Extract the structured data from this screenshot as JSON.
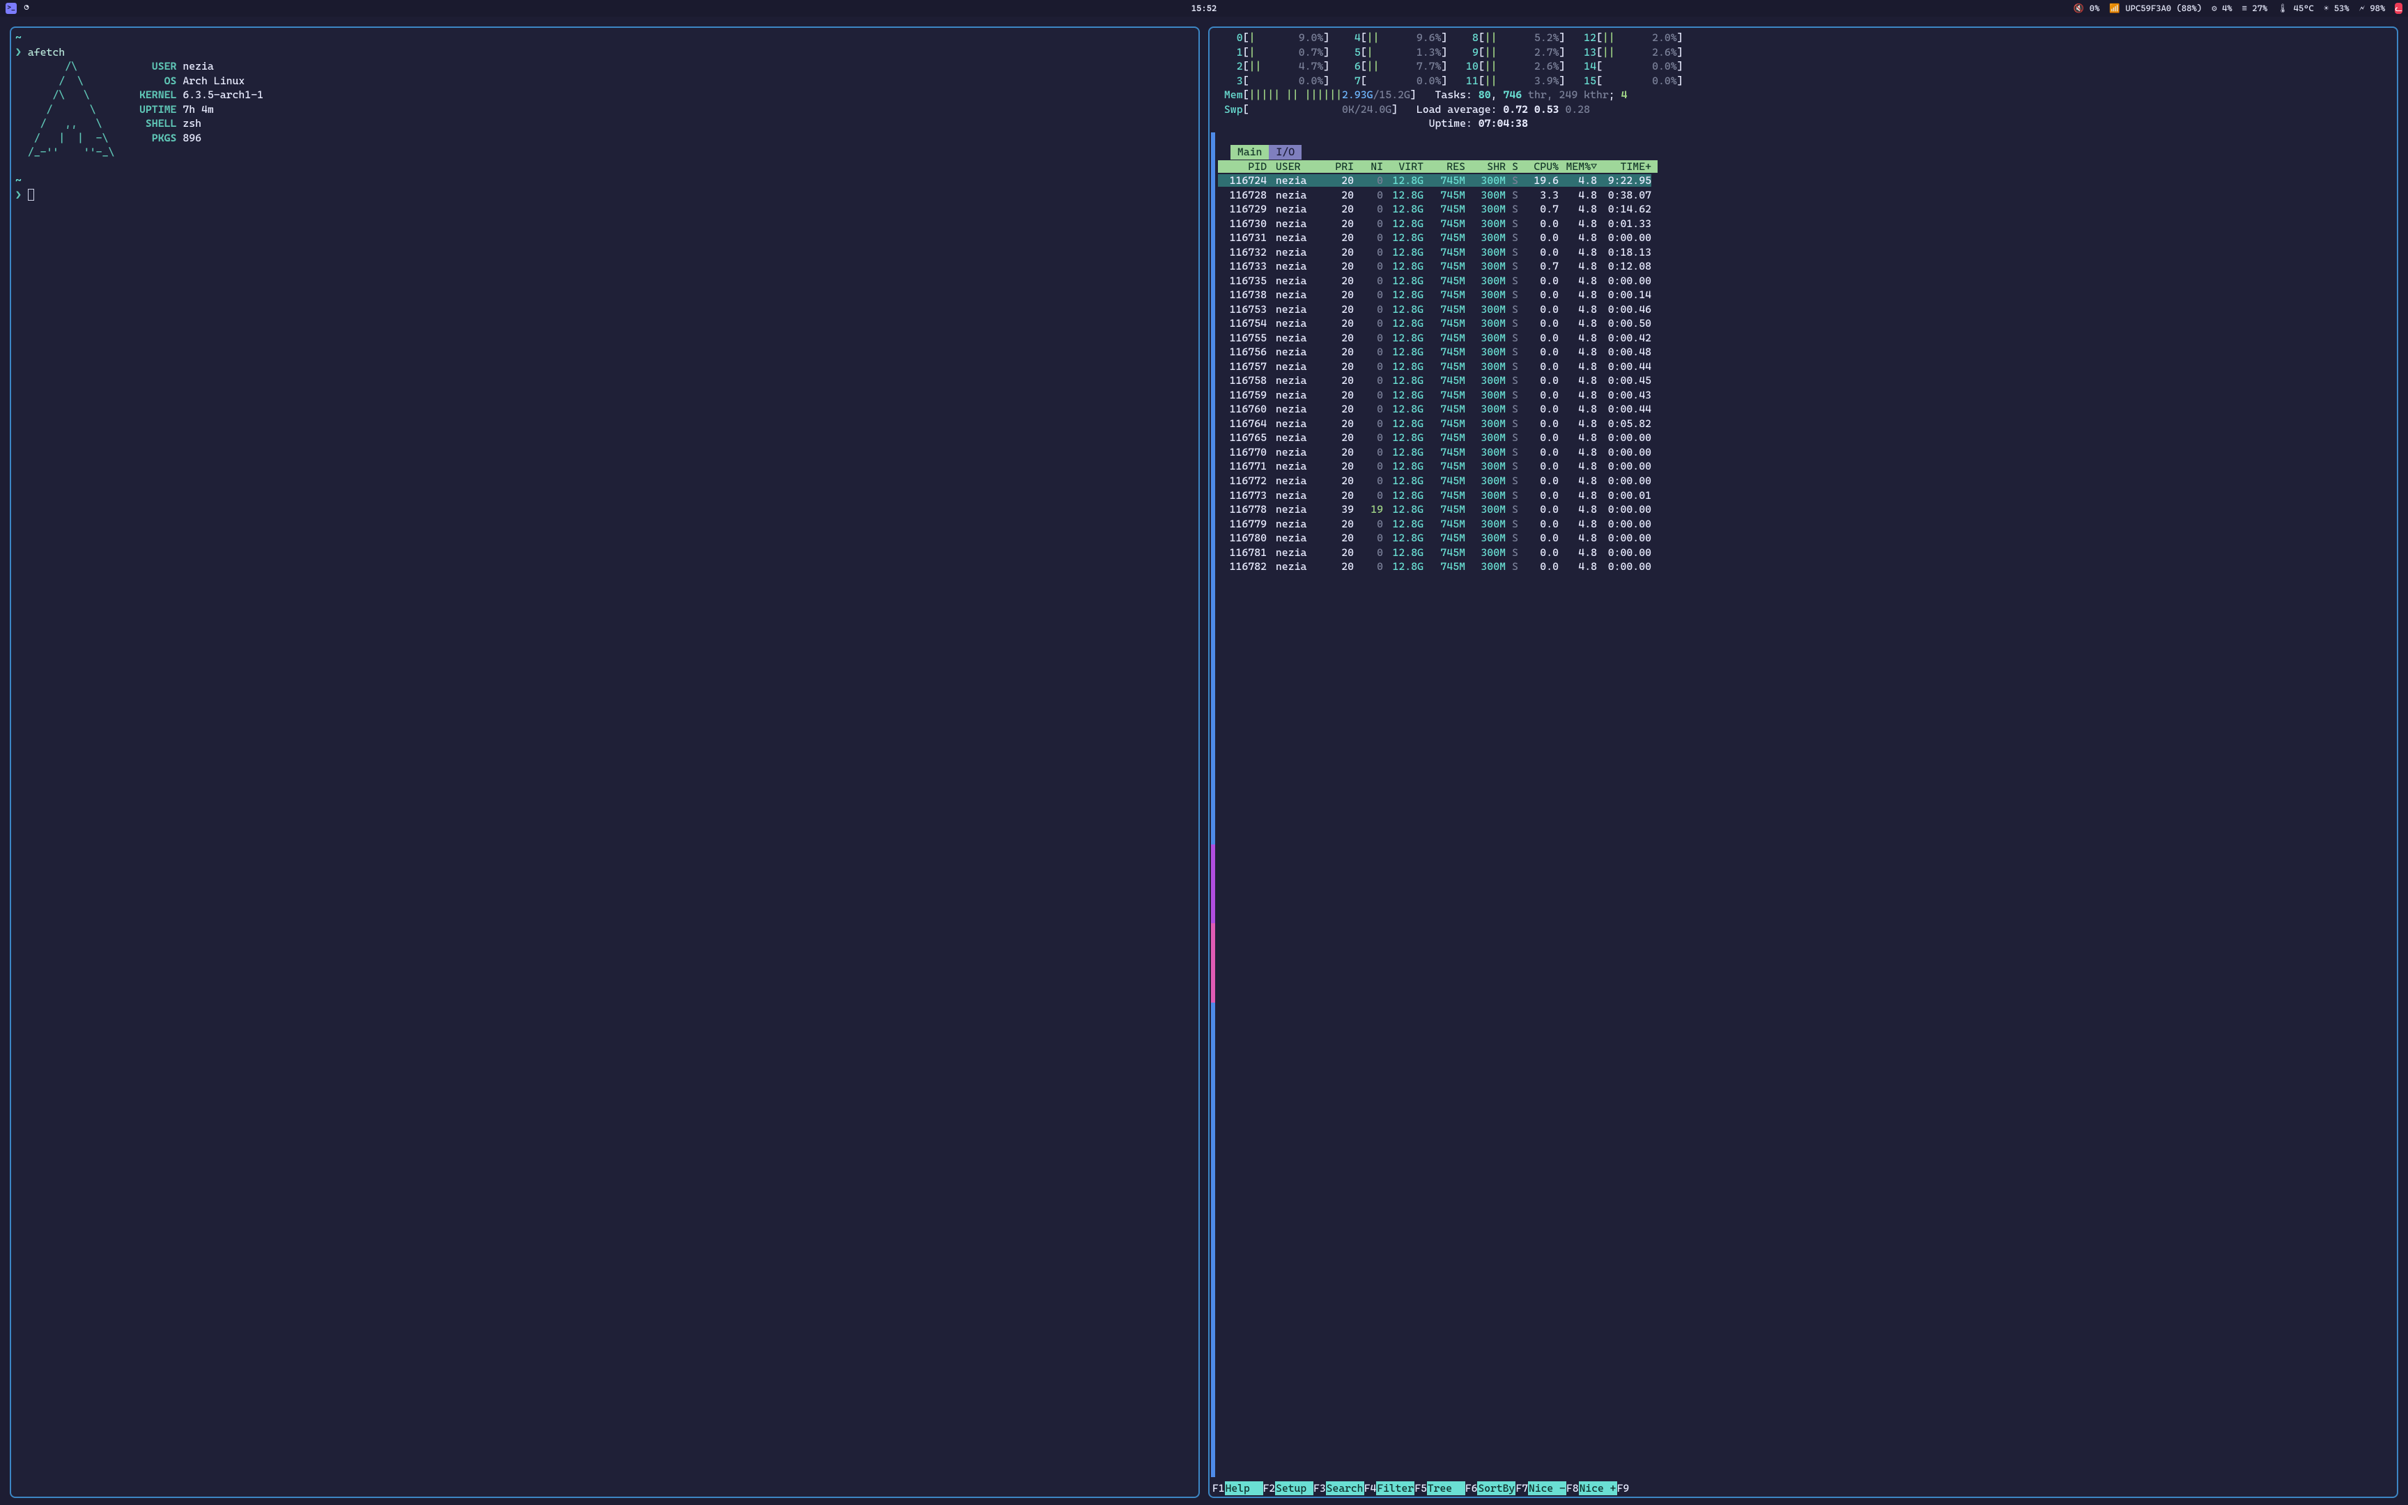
{
  "topbar": {
    "clock": "15:52",
    "volume_pct": "0%",
    "wifi_ssid": "UPC59F3A0",
    "wifi_signal_pct": "(88%)",
    "cpu_fan_pct": "4%",
    "mem_pct": "27%",
    "temp": "45°C",
    "brightness_pct": "53%",
    "battery_pct": "98%"
  },
  "left_pane": {
    "prompt_cmd": "afetch",
    "ascii": [
      "        /\\        ",
      "       /  \\       ",
      "      /\\   \\      ",
      "     /      \\     ",
      "    /   ,,   \\    ",
      "   /   |  |  -\\   ",
      "  /_-''    ''-_\\  "
    ],
    "fields": {
      "USER": "nezia",
      "OS": "Arch Linux",
      "KERNEL": "6.3.5-arch1-1",
      "UPTIME": "7h 4m",
      "SHELL": "zsh",
      "PKGS": "896"
    }
  },
  "htop": {
    "cpu_meters": [
      {
        "n": "0",
        "bar": "|",
        "pct": "9.0%"
      },
      {
        "n": "1",
        "bar": "|",
        "pct": "0.7%"
      },
      {
        "n": "2",
        "bar": "||",
        "pct": "4.7%"
      },
      {
        "n": "3",
        "bar": "",
        "pct": "0.0%"
      },
      {
        "n": "4",
        "bar": "||",
        "pct": "9.6%"
      },
      {
        "n": "5",
        "bar": "|",
        "pct": "1.3%"
      },
      {
        "n": "6",
        "bar": "||",
        "pct": "7.7%"
      },
      {
        "n": "7",
        "bar": "",
        "pct": "0.0%"
      },
      {
        "n": "8",
        "bar": "||",
        "pct": "5.2%"
      },
      {
        "n": "9",
        "bar": "||",
        "pct": "2.7%"
      },
      {
        "n": "10",
        "bar": "||",
        "pct": "2.6%"
      },
      {
        "n": "11",
        "bar": "||",
        "pct": "3.9%"
      },
      {
        "n": "12",
        "bar": "||",
        "pct": "2.0%"
      },
      {
        "n": "13",
        "bar": "||",
        "pct": "2.6%"
      },
      {
        "n": "14",
        "bar": "",
        "pct": "0.0%"
      },
      {
        "n": "15",
        "bar": "",
        "pct": "0.0%"
      }
    ],
    "mem_label": "Mem",
    "mem_bar": "||||| || ||||||",
    "mem_used": "2.93G",
    "mem_total": "15.2G",
    "swp_label": "Swp",
    "swp_used": "0K",
    "swp_total": "24.0G",
    "tasks_label": "Tasks:",
    "tasks_procs": "80",
    "tasks_thr": "746",
    "tasks_thr_suffix": "thr",
    "tasks_kthr": "249",
    "tasks_kthr_suffix": "kthr",
    "tasks_running": "4",
    "loadavg_label": "Load average:",
    "loadavg": [
      "0.72",
      "0.53",
      "0.28"
    ],
    "uptime_label": "Uptime:",
    "uptime": "07:04:38",
    "tabs": {
      "main": "Main",
      "io": "I/O"
    },
    "columns": [
      "PID",
      "USER",
      "PRI",
      "NI",
      "VIRT",
      "RES",
      "SHR",
      "S",
      "CPU%",
      "MEM%▽",
      "TIME+"
    ],
    "rows": [
      {
        "pid": "116724",
        "user": "nezia",
        "pri": "20",
        "ni": "0",
        "virt": "12.8G",
        "res": "745M",
        "shr": "300M",
        "s": "S",
        "cpu": "19.6",
        "mem": "4.8",
        "time": "9:22.95",
        "sel": true
      },
      {
        "pid": "116728",
        "user": "nezia",
        "pri": "20",
        "ni": "0",
        "virt": "12.8G",
        "res": "745M",
        "shr": "300M",
        "s": "S",
        "cpu": "3.3",
        "mem": "4.8",
        "time": "0:38.07"
      },
      {
        "pid": "116729",
        "user": "nezia",
        "pri": "20",
        "ni": "0",
        "virt": "12.8G",
        "res": "745M",
        "shr": "300M",
        "s": "S",
        "cpu": "0.7",
        "mem": "4.8",
        "time": "0:14.62"
      },
      {
        "pid": "116730",
        "user": "nezia",
        "pri": "20",
        "ni": "0",
        "virt": "12.8G",
        "res": "745M",
        "shr": "300M",
        "s": "S",
        "cpu": "0.0",
        "mem": "4.8",
        "time": "0:01.33"
      },
      {
        "pid": "116731",
        "user": "nezia",
        "pri": "20",
        "ni": "0",
        "virt": "12.8G",
        "res": "745M",
        "shr": "300M",
        "s": "S",
        "cpu": "0.0",
        "mem": "4.8",
        "time": "0:00.00"
      },
      {
        "pid": "116732",
        "user": "nezia",
        "pri": "20",
        "ni": "0",
        "virt": "12.8G",
        "res": "745M",
        "shr": "300M",
        "s": "S",
        "cpu": "0.0",
        "mem": "4.8",
        "time": "0:18.13"
      },
      {
        "pid": "116733",
        "user": "nezia",
        "pri": "20",
        "ni": "0",
        "virt": "12.8G",
        "res": "745M",
        "shr": "300M",
        "s": "S",
        "cpu": "0.7",
        "mem": "4.8",
        "time": "0:12.08"
      },
      {
        "pid": "116735",
        "user": "nezia",
        "pri": "20",
        "ni": "0",
        "virt": "12.8G",
        "res": "745M",
        "shr": "300M",
        "s": "S",
        "cpu": "0.0",
        "mem": "4.8",
        "time": "0:00.00"
      },
      {
        "pid": "116738",
        "user": "nezia",
        "pri": "20",
        "ni": "0",
        "virt": "12.8G",
        "res": "745M",
        "shr": "300M",
        "s": "S",
        "cpu": "0.0",
        "mem": "4.8",
        "time": "0:00.14"
      },
      {
        "pid": "116753",
        "user": "nezia",
        "pri": "20",
        "ni": "0",
        "virt": "12.8G",
        "res": "745M",
        "shr": "300M",
        "s": "S",
        "cpu": "0.0",
        "mem": "4.8",
        "time": "0:00.46"
      },
      {
        "pid": "116754",
        "user": "nezia",
        "pri": "20",
        "ni": "0",
        "virt": "12.8G",
        "res": "745M",
        "shr": "300M",
        "s": "S",
        "cpu": "0.0",
        "mem": "4.8",
        "time": "0:00.50"
      },
      {
        "pid": "116755",
        "user": "nezia",
        "pri": "20",
        "ni": "0",
        "virt": "12.8G",
        "res": "745M",
        "shr": "300M",
        "s": "S",
        "cpu": "0.0",
        "mem": "4.8",
        "time": "0:00.42"
      },
      {
        "pid": "116756",
        "user": "nezia",
        "pri": "20",
        "ni": "0",
        "virt": "12.8G",
        "res": "745M",
        "shr": "300M",
        "s": "S",
        "cpu": "0.0",
        "mem": "4.8",
        "time": "0:00.48"
      },
      {
        "pid": "116757",
        "user": "nezia",
        "pri": "20",
        "ni": "0",
        "virt": "12.8G",
        "res": "745M",
        "shr": "300M",
        "s": "S",
        "cpu": "0.0",
        "mem": "4.8",
        "time": "0:00.44"
      },
      {
        "pid": "116758",
        "user": "nezia",
        "pri": "20",
        "ni": "0",
        "virt": "12.8G",
        "res": "745M",
        "shr": "300M",
        "s": "S",
        "cpu": "0.0",
        "mem": "4.8",
        "time": "0:00.45"
      },
      {
        "pid": "116759",
        "user": "nezia",
        "pri": "20",
        "ni": "0",
        "virt": "12.8G",
        "res": "745M",
        "shr": "300M",
        "s": "S",
        "cpu": "0.0",
        "mem": "4.8",
        "time": "0:00.43"
      },
      {
        "pid": "116760",
        "user": "nezia",
        "pri": "20",
        "ni": "0",
        "virt": "12.8G",
        "res": "745M",
        "shr": "300M",
        "s": "S",
        "cpu": "0.0",
        "mem": "4.8",
        "time": "0:00.44"
      },
      {
        "pid": "116764",
        "user": "nezia",
        "pri": "20",
        "ni": "0",
        "virt": "12.8G",
        "res": "745M",
        "shr": "300M",
        "s": "S",
        "cpu": "0.0",
        "mem": "4.8",
        "time": "0:05.82"
      },
      {
        "pid": "116765",
        "user": "nezia",
        "pri": "20",
        "ni": "0",
        "virt": "12.8G",
        "res": "745M",
        "shr": "300M",
        "s": "S",
        "cpu": "0.0",
        "mem": "4.8",
        "time": "0:00.00"
      },
      {
        "pid": "116770",
        "user": "nezia",
        "pri": "20",
        "ni": "0",
        "virt": "12.8G",
        "res": "745M",
        "shr": "300M",
        "s": "S",
        "cpu": "0.0",
        "mem": "4.8",
        "time": "0:00.00"
      },
      {
        "pid": "116771",
        "user": "nezia",
        "pri": "20",
        "ni": "0",
        "virt": "12.8G",
        "res": "745M",
        "shr": "300M",
        "s": "S",
        "cpu": "0.0",
        "mem": "4.8",
        "time": "0:00.00"
      },
      {
        "pid": "116772",
        "user": "nezia",
        "pri": "20",
        "ni": "0",
        "virt": "12.8G",
        "res": "745M",
        "shr": "300M",
        "s": "S",
        "cpu": "0.0",
        "mem": "4.8",
        "time": "0:00.00"
      },
      {
        "pid": "116773",
        "user": "nezia",
        "pri": "20",
        "ni": "0",
        "virt": "12.8G",
        "res": "745M",
        "shr": "300M",
        "s": "S",
        "cpu": "0.0",
        "mem": "4.8",
        "time": "0:00.01"
      },
      {
        "pid": "116778",
        "user": "nezia",
        "pri": "39",
        "ni": "19",
        "virt": "12.8G",
        "res": "745M",
        "shr": "300M",
        "s": "S",
        "cpu": "0.0",
        "mem": "4.8",
        "time": "0:00.00"
      },
      {
        "pid": "116779",
        "user": "nezia",
        "pri": "20",
        "ni": "0",
        "virt": "12.8G",
        "res": "745M",
        "shr": "300M",
        "s": "S",
        "cpu": "0.0",
        "mem": "4.8",
        "time": "0:00.00"
      },
      {
        "pid": "116780",
        "user": "nezia",
        "pri": "20",
        "ni": "0",
        "virt": "12.8G",
        "res": "745M",
        "shr": "300M",
        "s": "S",
        "cpu": "0.0",
        "mem": "4.8",
        "time": "0:00.00"
      },
      {
        "pid": "116781",
        "user": "nezia",
        "pri": "20",
        "ni": "0",
        "virt": "12.8G",
        "res": "745M",
        "shr": "300M",
        "s": "S",
        "cpu": "0.0",
        "mem": "4.8",
        "time": "0:00.00"
      },
      {
        "pid": "116782",
        "user": "nezia",
        "pri": "20",
        "ni": "0",
        "virt": "12.8G",
        "res": "745M",
        "shr": "300M",
        "s": "S",
        "cpu": "0.0",
        "mem": "4.8",
        "time": "0:00.00"
      }
    ],
    "fnkeys": [
      {
        "k": "F1",
        "l": "Help  "
      },
      {
        "k": "F2",
        "l": "Setup "
      },
      {
        "k": "F3",
        "l": "Search"
      },
      {
        "k": "F4",
        "l": "Filter"
      },
      {
        "k": "F5",
        "l": "Tree  "
      },
      {
        "k": "F6",
        "l": "SortBy"
      },
      {
        "k": "F7",
        "l": "Nice -"
      },
      {
        "k": "F8",
        "l": "Nice +"
      },
      {
        "k": "F9",
        "l": ""
      }
    ],
    "gutter_colors": [
      "#4e8be8",
      "#4e8be8",
      "#4e8be8",
      "#4e8be8",
      "#4e8be8",
      "#4e8be8",
      "#4e8be8",
      "#4e8be8",
      "#4e8be8",
      "#b14ee0",
      "#e05bb3",
      "#4e8be8",
      "#4e8be8",
      "#4e8be8",
      "#4e8be8",
      "#4e8be8",
      "#4e8be8"
    ]
  }
}
